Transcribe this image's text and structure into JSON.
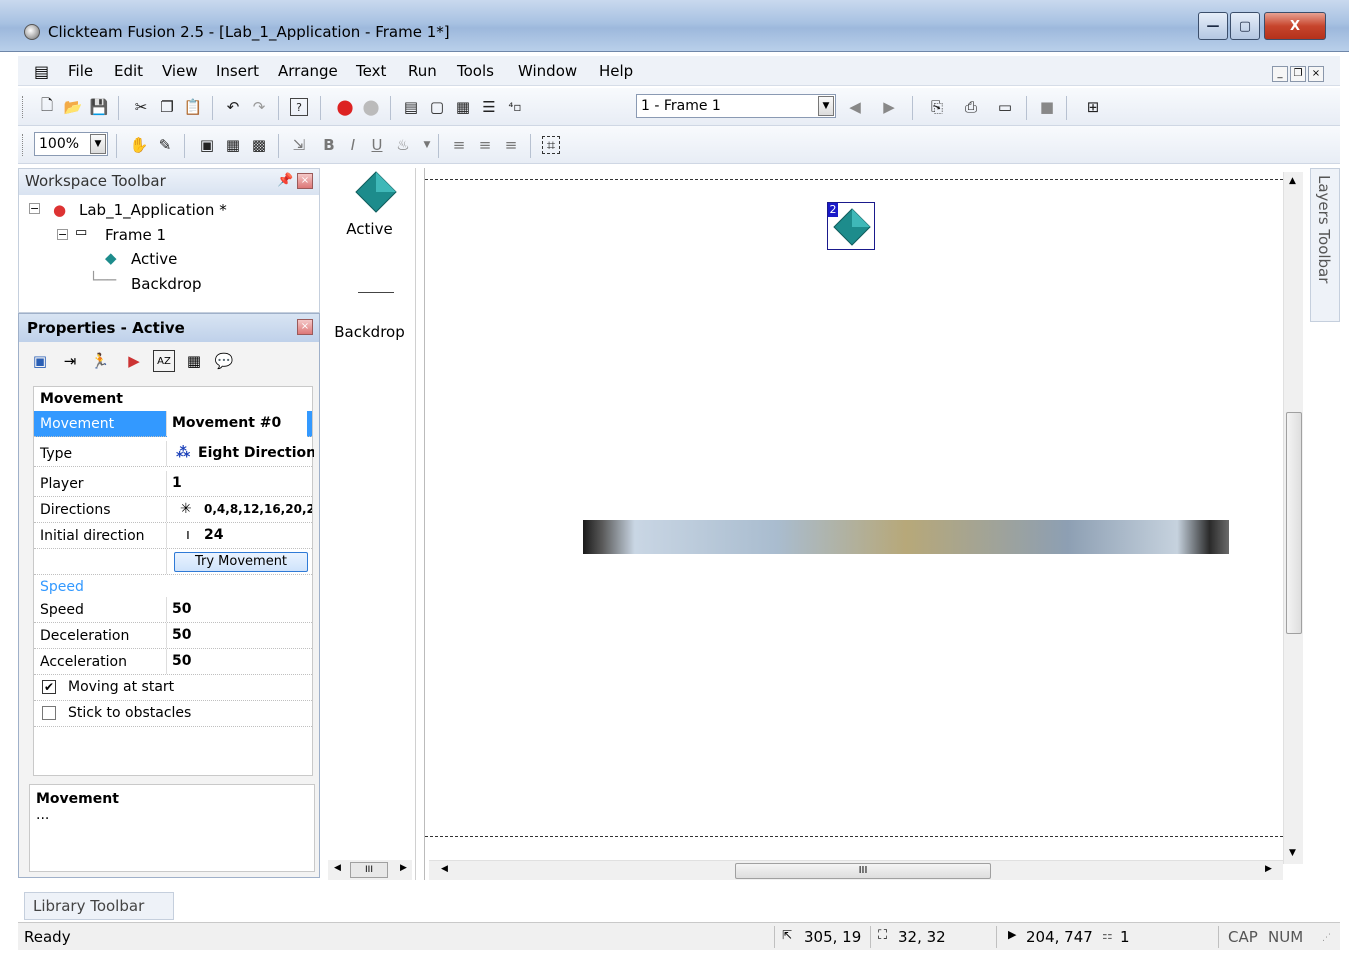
{
  "window": {
    "title": "Clickteam Fusion 2.5 - [Lab_1_Application - Frame 1*]",
    "min_label": "—",
    "max_label": "▢",
    "close_label": "X"
  },
  "menubar": {
    "items": [
      "File",
      "Edit",
      "View",
      "Insert",
      "Arrange",
      "Text",
      "Run",
      "Tools",
      "Window",
      "Help"
    ]
  },
  "toolbar": {
    "frame_select": "1 - Frame 1",
    "zoom": "100%"
  },
  "workspace": {
    "title": "Workspace Toolbar",
    "tree": {
      "application": "Lab_1_Application *",
      "frame": "Frame 1",
      "active": "Active",
      "backdrop": "Backdrop"
    }
  },
  "properties": {
    "title": "Properties - Active",
    "section_movement": "Movement",
    "rows": [
      {
        "key": "Movement",
        "value": "Movement #0"
      },
      {
        "key": "Type",
        "value": "Eight Directions"
      },
      {
        "key": "Player",
        "value": "1"
      },
      {
        "key": "Directions",
        "value": "0,4,8,12,16,20,2"
      },
      {
        "key": "Initial direction",
        "value": "24"
      }
    ],
    "try_button": "Try Movement",
    "section_speed": "Speed",
    "speed_rows": [
      {
        "key": "Speed",
        "value": "50"
      },
      {
        "key": "Deceleration",
        "value": "50"
      },
      {
        "key": "Acceleration",
        "value": "50"
      }
    ],
    "moving_at_start": "Moving at start",
    "stick_to_obstacles": "Stick to obstacles",
    "description_title": "Movement",
    "description_text": "..."
  },
  "object_list": {
    "active_label": "Active",
    "backdrop_label": "Backdrop"
  },
  "editor": {
    "object_badge": "2"
  },
  "layers": {
    "title": "Layers Toolbar"
  },
  "library": {
    "title": "Library Toolbar"
  },
  "status": {
    "ready": "Ready",
    "position": "305, 19",
    "size": "32, 32",
    "cursor": "204, 747",
    "count": "1",
    "cap": "CAP",
    "num": "NUM"
  },
  "colors": {
    "accent": "#3399ff",
    "active_diamond": "#1d8c8c",
    "speed_heading": "#3399ff"
  }
}
